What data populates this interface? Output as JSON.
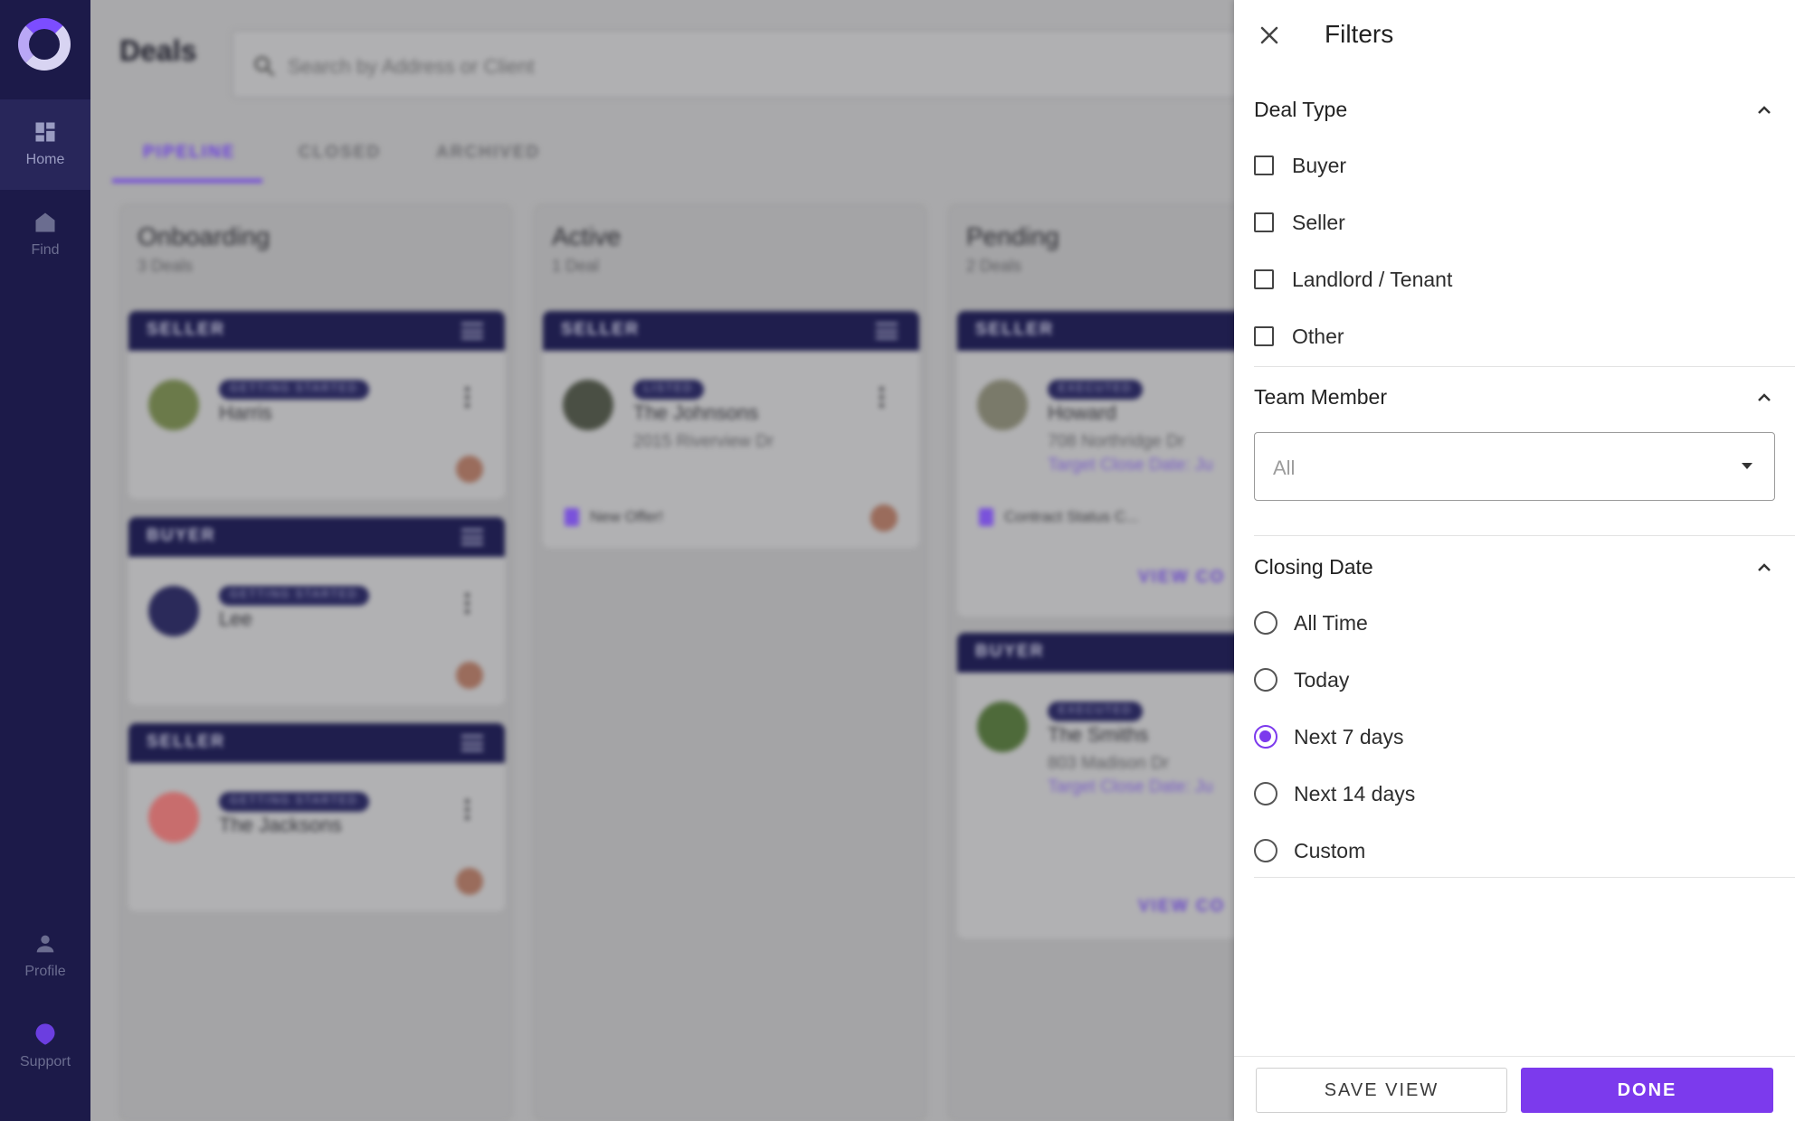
{
  "nav": {
    "items": [
      {
        "label": "Home",
        "icon": "dashboard-icon"
      },
      {
        "label": "Find",
        "icon": "house-icon"
      },
      {
        "label": "Profile",
        "icon": "person-icon"
      },
      {
        "label": "Support",
        "icon": "support-icon"
      }
    ]
  },
  "header": {
    "title": "Deals",
    "search_placeholder": "Search by Address or Client"
  },
  "tabs": [
    {
      "label": "PIPELINE",
      "active": true
    },
    {
      "label": "CLOSED",
      "active": false
    },
    {
      "label": "ARCHIVED",
      "active": false
    }
  ],
  "columns": [
    {
      "title": "Onboarding",
      "count": "3 Deals",
      "cards": [
        {
          "type": "SELLER",
          "status": "GETTING STARTED",
          "name": "Harris"
        },
        {
          "type": "BUYER",
          "status": "GETTING STARTED",
          "name": "Lee"
        },
        {
          "type": "SELLER",
          "status": "GETTING STARTED",
          "name": "The Jacksons"
        }
      ]
    },
    {
      "title": "Active",
      "count": "1 Deal",
      "cards": [
        {
          "type": "SELLER",
          "status": "LISTED",
          "name": "The Johnsons",
          "address": "2015 Riverview Dr",
          "note": "New Offer!"
        }
      ]
    },
    {
      "title": "Pending",
      "count": "2 Deals",
      "cards": [
        {
          "type": "SELLER",
          "status": "EXECUTED",
          "name": "Howard",
          "address": "708 Northridge Dr",
          "date": "Target Close Date: Ju",
          "note": "Contract Status C...",
          "link": "VIEW CO"
        },
        {
          "type": "BUYER",
          "status": "EXECUTED",
          "name": "The Smiths",
          "address": "803 Madison Dr",
          "date": "Target Close Date: Ju",
          "link": "VIEW CO"
        }
      ]
    }
  ],
  "filters": {
    "title": "Filters",
    "deal_type": {
      "heading": "Deal Type",
      "options": [
        "Buyer",
        "Seller",
        "Landlord / Tenant",
        "Other"
      ]
    },
    "team_member": {
      "heading": "Team Member",
      "value": "All"
    },
    "closing_date": {
      "heading": "Closing Date",
      "options": [
        "All Time",
        "Today",
        "Next 7 days",
        "Next 14 days",
        "Custom"
      ],
      "selected": "Next 7 days"
    },
    "save_label": "SAVE VIEW",
    "done_label": "DONE"
  },
  "colors": {
    "accent": "#7c3aed",
    "nav_bg": "#1c1a49",
    "card_header": "#1f1e4d"
  }
}
